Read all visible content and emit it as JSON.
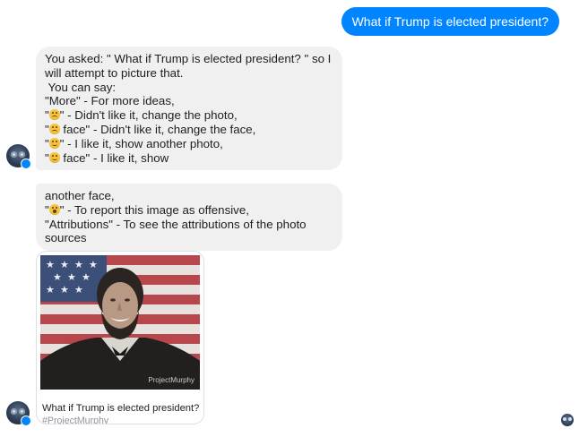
{
  "outgoing": {
    "text": "What if Trump is elected president?"
  },
  "bot_message_1": {
    "l1": "You asked: \" What if Trump is elected president? \" so I",
    "l2": "will attempt to picture that.",
    "l3": " You can say:",
    "l4": "\"More\" - For more ideas,",
    "l5_pre": "\"",
    "l5_post": "\" - Didn't like it, change the photo,",
    "l6_pre": "\"",
    "l6_post": " face\" - Didn't like it, change the face,",
    "l7_pre": "\"",
    "l7_post": "\" - I like it, show another photo,",
    "l8_pre": "\"",
    "l8_post": " face\" - I like it, show"
  },
  "bot_message_2": {
    "l1": "another face,",
    "l2_pre": "\"",
    "l2_post": "\" - To report this image as offensive,",
    "l3": "\"Attributions\" - To see the attributions of the photo",
    "l4": "sources"
  },
  "emoji": {
    "dislike": "disappointed-face-icon",
    "like": "slightly-smiling-face-icon",
    "report": "astonished-face-icon"
  },
  "card": {
    "title": "What if Trump is elected president?",
    "subtitle": "#ProjectMurphy",
    "watermark": "ProjectMurphy"
  },
  "colors": {
    "outgoing_bubble": "#0084ff",
    "incoming_bubble": "#f1f0f0",
    "messenger_badge": "#0084ff"
  }
}
